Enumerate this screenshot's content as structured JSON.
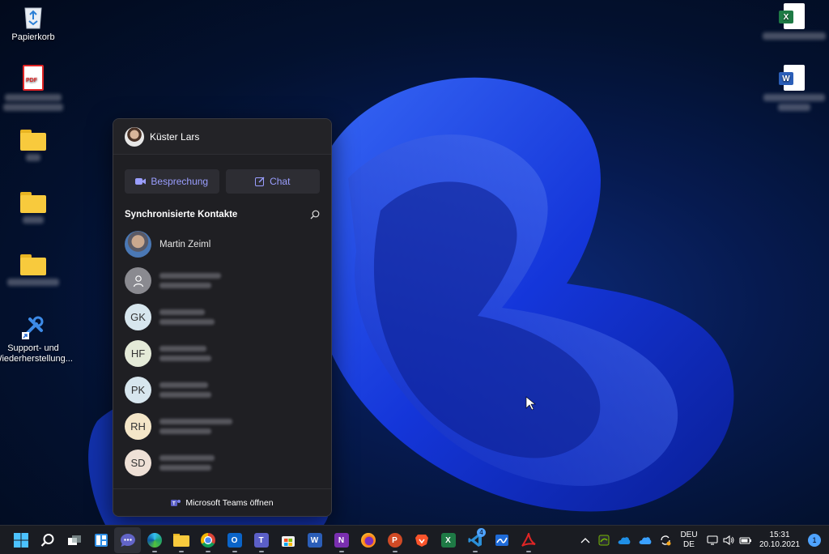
{
  "desktop": {
    "icons": [
      {
        "label": "Papierkorb",
        "icon": "recycle-bin-icon"
      },
      {
        "label": "",
        "icon": "pdf-file-icon"
      },
      {
        "label": "",
        "icon": "folder-icon"
      },
      {
        "label": "",
        "icon": "folder-icon"
      },
      {
        "label": "",
        "icon": "folder-icon"
      },
      {
        "label": "Support- und Wiederherstellung...",
        "icon": "support-tools-icon"
      },
      {
        "label": "",
        "icon": "excel-file-icon"
      },
      {
        "label": "",
        "icon": "word-file-icon"
      }
    ],
    "pdf_badge": "PDF",
    "excel_badge": "X",
    "word_badge": "W"
  },
  "chat_flyout": {
    "user_name": "Küster Lars",
    "meeting_button": "Besprechung",
    "chat_button": "Chat",
    "section_title": "Synchronisierte Kontakte",
    "contacts": [
      {
        "initials": "",
        "name": "Martin Zeiml",
        "avatar": "photo"
      },
      {
        "initials": "",
        "name": "",
        "avatar": "placeholder"
      },
      {
        "initials": "GK",
        "name": "",
        "avatar": "initials",
        "color": "#d7e6ee"
      },
      {
        "initials": "HF",
        "name": "",
        "avatar": "initials",
        "color": "#e4ead8"
      },
      {
        "initials": "PK",
        "name": "",
        "avatar": "initials",
        "color": "#d7e6ee"
      },
      {
        "initials": "RH",
        "name": "",
        "avatar": "initials",
        "color": "#f4e6c8"
      },
      {
        "initials": "SD",
        "name": "",
        "avatar": "initials",
        "color": "#eee0d6"
      }
    ],
    "footer_label": "Microsoft Teams öffnen",
    "accent_color": "#9a9eff"
  },
  "taskbar": {
    "apps": [
      {
        "name": "start",
        "icon": "windows-start-icon"
      },
      {
        "name": "search",
        "icon": "search-icon"
      },
      {
        "name": "task-view",
        "icon": "task-view-icon"
      },
      {
        "name": "widgets",
        "icon": "widgets-icon"
      },
      {
        "name": "chat",
        "icon": "teams-chat-icon"
      },
      {
        "name": "edge",
        "icon": "edge-icon"
      },
      {
        "name": "explorer",
        "icon": "file-explorer-icon"
      },
      {
        "name": "chrome",
        "icon": "chrome-icon"
      },
      {
        "name": "outlook",
        "icon": "outlook-icon"
      },
      {
        "name": "teams",
        "icon": "teams-icon"
      },
      {
        "name": "store",
        "icon": "store-icon"
      },
      {
        "name": "word",
        "icon": "word-icon"
      },
      {
        "name": "onenote",
        "icon": "onenote-icon"
      },
      {
        "name": "firefox",
        "icon": "firefox-icon"
      },
      {
        "name": "powerpoint",
        "icon": "powerpoint-icon"
      },
      {
        "name": "brave",
        "icon": "brave-icon"
      },
      {
        "name": "excel",
        "icon": "excel-icon"
      },
      {
        "name": "vscode",
        "icon": "vscode-icon"
      },
      {
        "name": "whiteboard",
        "icon": "whiteboard-icon"
      },
      {
        "name": "acrobat",
        "icon": "acrobat-icon"
      }
    ],
    "vscode_badge": "4",
    "language_top": "DEU",
    "language_bottom": "DE",
    "time": "15:31",
    "date": "20.10.2021",
    "notification_count": "1"
  }
}
